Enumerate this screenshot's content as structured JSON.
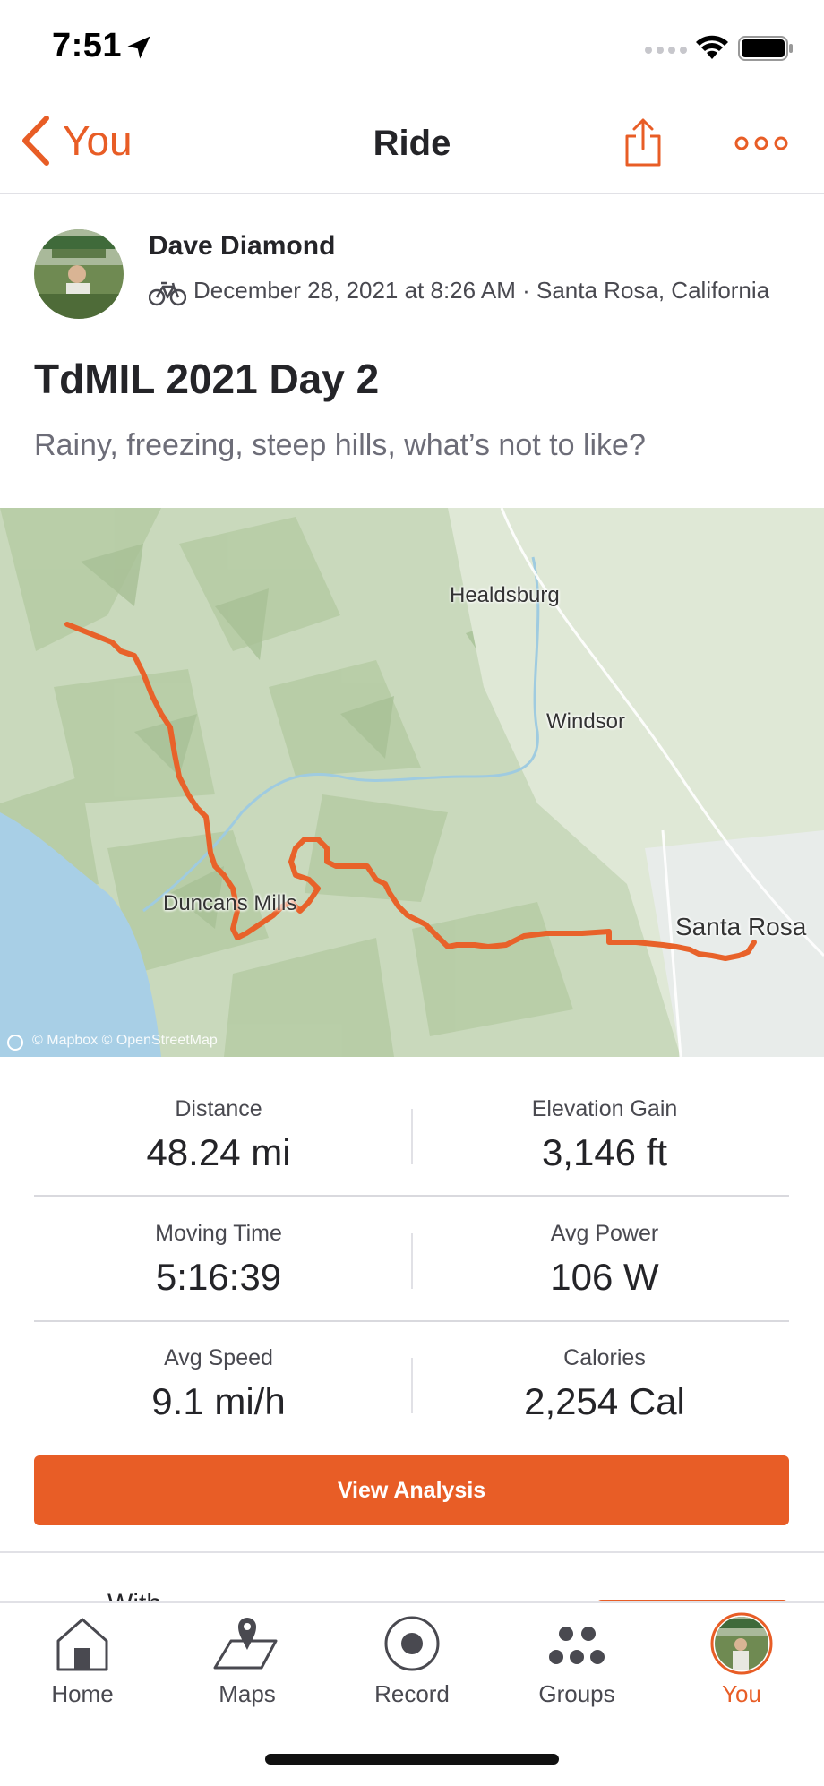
{
  "status": {
    "time": "7:51"
  },
  "nav": {
    "back_label": "You",
    "title": "Ride"
  },
  "activity": {
    "athlete": "Dave Diamond",
    "meta": "December 28, 2021 at 8:26 AM · Santa Rosa, California",
    "title": "TdMIL 2021 Day 2",
    "description": "Rainy, freezing, steep hills, what’s not to like?"
  },
  "map": {
    "places": [
      "Healdsburg",
      "Windsor",
      "Duncans Mills",
      "Santa Rosa"
    ],
    "attribution": "© Mapbox © OpenStreetMap",
    "route_color": "#E8622A"
  },
  "stats": [
    {
      "label": "Distance",
      "value": "48.24 mi"
    },
    {
      "label": "Elevation Gain",
      "value": "3,146 ft"
    },
    {
      "label": "Moving Time",
      "value": "5:16:39"
    },
    {
      "label": "Avg Power",
      "value": "106 W"
    },
    {
      "label": "Avg Speed",
      "value": "9.1 mi/h"
    },
    {
      "label": "Calories",
      "value": "2,254 Cal"
    }
  ],
  "analysis_button": "View Analysis",
  "peek_text": "With",
  "tabs": [
    {
      "label": "Home",
      "icon": "home-icon"
    },
    {
      "label": "Maps",
      "icon": "map-pin-icon"
    },
    {
      "label": "Record",
      "icon": "record-icon"
    },
    {
      "label": "Groups",
      "icon": "groups-icon"
    },
    {
      "label": "You",
      "icon": "avatar-icon"
    }
  ],
  "colors": {
    "accent": "#E85D26",
    "text": "#242428",
    "muted": "#6d6d78"
  }
}
